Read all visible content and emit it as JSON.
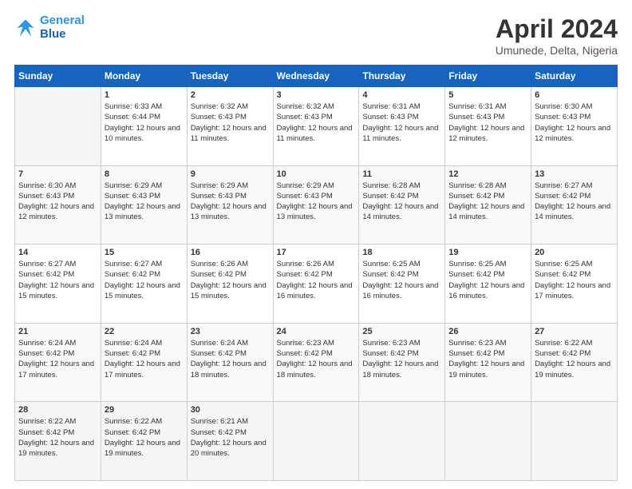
{
  "header": {
    "logo_line1": "General",
    "logo_line2": "Blue",
    "title": "April 2024",
    "subtitle": "Umunede, Delta, Nigeria"
  },
  "weekdays": [
    "Sunday",
    "Monday",
    "Tuesday",
    "Wednesday",
    "Thursday",
    "Friday",
    "Saturday"
  ],
  "weeks": [
    [
      {
        "day": "",
        "sunrise": "",
        "sunset": "",
        "daylight": ""
      },
      {
        "day": "1",
        "sunrise": "6:33 AM",
        "sunset": "6:44 PM",
        "daylight": "12 hours and 10 minutes."
      },
      {
        "day": "2",
        "sunrise": "6:32 AM",
        "sunset": "6:43 PM",
        "daylight": "12 hours and 11 minutes."
      },
      {
        "day": "3",
        "sunrise": "6:32 AM",
        "sunset": "6:43 PM",
        "daylight": "12 hours and 11 minutes."
      },
      {
        "day": "4",
        "sunrise": "6:31 AM",
        "sunset": "6:43 PM",
        "daylight": "12 hours and 11 minutes."
      },
      {
        "day": "5",
        "sunrise": "6:31 AM",
        "sunset": "6:43 PM",
        "daylight": "12 hours and 12 minutes."
      },
      {
        "day": "6",
        "sunrise": "6:30 AM",
        "sunset": "6:43 PM",
        "daylight": "12 hours and 12 minutes."
      }
    ],
    [
      {
        "day": "7",
        "sunrise": "6:30 AM",
        "sunset": "6:43 PM",
        "daylight": "12 hours and 12 minutes."
      },
      {
        "day": "8",
        "sunrise": "6:29 AM",
        "sunset": "6:43 PM",
        "daylight": "12 hours and 13 minutes."
      },
      {
        "day": "9",
        "sunrise": "6:29 AM",
        "sunset": "6:43 PM",
        "daylight": "12 hours and 13 minutes."
      },
      {
        "day": "10",
        "sunrise": "6:29 AM",
        "sunset": "6:43 PM",
        "daylight": "12 hours and 13 minutes."
      },
      {
        "day": "11",
        "sunrise": "6:28 AM",
        "sunset": "6:42 PM",
        "daylight": "12 hours and 14 minutes."
      },
      {
        "day": "12",
        "sunrise": "6:28 AM",
        "sunset": "6:42 PM",
        "daylight": "12 hours and 14 minutes."
      },
      {
        "day": "13",
        "sunrise": "6:27 AM",
        "sunset": "6:42 PM",
        "daylight": "12 hours and 14 minutes."
      }
    ],
    [
      {
        "day": "14",
        "sunrise": "6:27 AM",
        "sunset": "6:42 PM",
        "daylight": "12 hours and 15 minutes."
      },
      {
        "day": "15",
        "sunrise": "6:27 AM",
        "sunset": "6:42 PM",
        "daylight": "12 hours and 15 minutes."
      },
      {
        "day": "16",
        "sunrise": "6:26 AM",
        "sunset": "6:42 PM",
        "daylight": "12 hours and 15 minutes."
      },
      {
        "day": "17",
        "sunrise": "6:26 AM",
        "sunset": "6:42 PM",
        "daylight": "12 hours and 16 minutes."
      },
      {
        "day": "18",
        "sunrise": "6:25 AM",
        "sunset": "6:42 PM",
        "daylight": "12 hours and 16 minutes."
      },
      {
        "day": "19",
        "sunrise": "6:25 AM",
        "sunset": "6:42 PM",
        "daylight": "12 hours and 16 minutes."
      },
      {
        "day": "20",
        "sunrise": "6:25 AM",
        "sunset": "6:42 PM",
        "daylight": "12 hours and 17 minutes."
      }
    ],
    [
      {
        "day": "21",
        "sunrise": "6:24 AM",
        "sunset": "6:42 PM",
        "daylight": "12 hours and 17 minutes."
      },
      {
        "day": "22",
        "sunrise": "6:24 AM",
        "sunset": "6:42 PM",
        "daylight": "12 hours and 17 minutes."
      },
      {
        "day": "23",
        "sunrise": "6:24 AM",
        "sunset": "6:42 PM",
        "daylight": "12 hours and 18 minutes."
      },
      {
        "day": "24",
        "sunrise": "6:23 AM",
        "sunset": "6:42 PM",
        "daylight": "12 hours and 18 minutes."
      },
      {
        "day": "25",
        "sunrise": "6:23 AM",
        "sunset": "6:42 PM",
        "daylight": "12 hours and 18 minutes."
      },
      {
        "day": "26",
        "sunrise": "6:23 AM",
        "sunset": "6:42 PM",
        "daylight": "12 hours and 19 minutes."
      },
      {
        "day": "27",
        "sunrise": "6:22 AM",
        "sunset": "6:42 PM",
        "daylight": "12 hours and 19 minutes."
      }
    ],
    [
      {
        "day": "28",
        "sunrise": "6:22 AM",
        "sunset": "6:42 PM",
        "daylight": "12 hours and 19 minutes."
      },
      {
        "day": "29",
        "sunrise": "6:22 AM",
        "sunset": "6:42 PM",
        "daylight": "12 hours and 19 minutes."
      },
      {
        "day": "30",
        "sunrise": "6:21 AM",
        "sunset": "6:42 PM",
        "daylight": "12 hours and 20 minutes."
      },
      {
        "day": "",
        "sunrise": "",
        "sunset": "",
        "daylight": ""
      },
      {
        "day": "",
        "sunrise": "",
        "sunset": "",
        "daylight": ""
      },
      {
        "day": "",
        "sunrise": "",
        "sunset": "",
        "daylight": ""
      },
      {
        "day": "",
        "sunrise": "",
        "sunset": "",
        "daylight": ""
      }
    ]
  ]
}
